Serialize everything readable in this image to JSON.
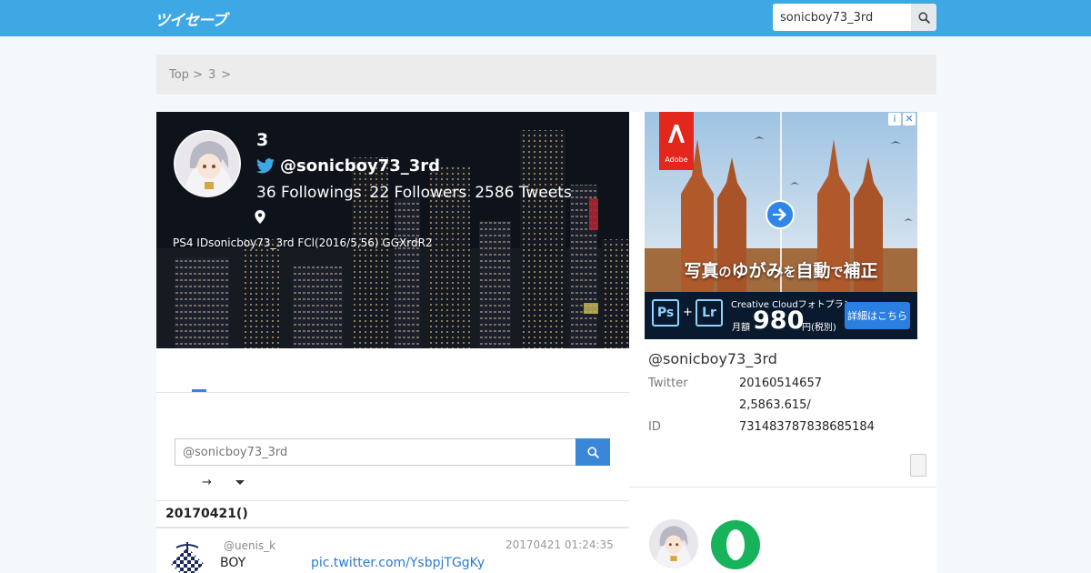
{
  "header": {
    "logo_text": "ツイセーブ",
    "search_value": "sonicboy73_3rd"
  },
  "page_tick": "'",
  "breadcrumb": [
    "Top >",
    "3",
    ">"
  ],
  "profile": {
    "name": "3",
    "handle": "@sonicboy73_3rd",
    "followings": "36 Followings",
    "followers": "22 Followers",
    "tweets": "2586 Tweets",
    "bio": "PS4 IDsonicboy73_3rd FCl(2016/5,56) GGXrdR2"
  },
  "feed": {
    "search_placeholder": "@sonicboy73_3rd",
    "sort_arrow": "→",
    "date_heading": "20170421()",
    "tweet": {
      "user": "@uenis_k",
      "time": "20170421 01:24:35",
      "text": "BOY",
      "link": "pic.twitter.com/YsbpjTGgKy"
    }
  },
  "ad": {
    "brand": "Adobe",
    "headline_parts": [
      "写真",
      "の",
      "ゆがみ",
      "を",
      "自動",
      "で",
      "補正"
    ],
    "app1": "Ps",
    "app2": "Lr",
    "plus": "+",
    "plan": "Creative Cloudフォトプラン",
    "month_label": "月額",
    "price": "980",
    "price_suffix": "円(税別)",
    "cta": "詳細はこちら",
    "info_icon": "i",
    "close_icon": "✕"
  },
  "side_info": {
    "handle": "@sonicboy73_3rd",
    "rows": [
      {
        "label": "Twitter",
        "value": "20160514657"
      },
      {
        "label": "",
        "value": "2,5863.615/"
      },
      {
        "label": "ID",
        "value": "731483787838685184"
      }
    ]
  },
  "colors": {
    "topbar": "#3ea8e5",
    "search_button": "#3a86d8",
    "link": "#2a7bd4",
    "tab_indicator": "#3e7de6",
    "green_icon": "#16b35a"
  },
  "icons": {
    "search": "search-icon",
    "bird": "twitter-bird-icon",
    "location": "map-pin-icon"
  }
}
